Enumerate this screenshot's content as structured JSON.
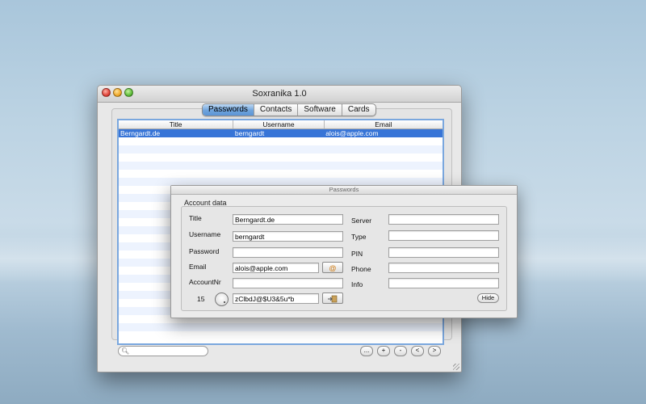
{
  "window": {
    "title": "Soxranika 1.0"
  },
  "tabs": [
    {
      "label": "Passwords",
      "active": true
    },
    {
      "label": "Contacts",
      "active": false
    },
    {
      "label": "Software",
      "active": false
    },
    {
      "label": "Cards",
      "active": false
    }
  ],
  "table": {
    "columns": [
      "Title",
      "Username",
      "Email"
    ],
    "rows": [
      {
        "title": "Berngardt.de",
        "username": "berngardt",
        "email": "alois@apple.com",
        "selected": true
      }
    ]
  },
  "footer": {
    "search_icon": "magnifier-icon",
    "buttons": [
      "...",
      "+",
      "-",
      "<",
      ">"
    ]
  },
  "panel": {
    "title": "Passwords",
    "group_label": "Account data",
    "left_fields": {
      "title": {
        "label": "Title",
        "value": "Berngardt.de"
      },
      "username": {
        "label": "Username",
        "value": "berngardt"
      },
      "password": {
        "label": "Password",
        "value": ""
      },
      "email": {
        "label": "Email",
        "value": "alois@apple.com"
      },
      "account_nr": {
        "label": "AccountNr",
        "value": ""
      }
    },
    "right_fields": {
      "server": {
        "label": "Server",
        "value": ""
      },
      "type": {
        "label": "Type",
        "value": ""
      },
      "pin": {
        "label": "PIN",
        "value": ""
      },
      "phone": {
        "label": "Phone",
        "value": ""
      },
      "info": {
        "label": "Info",
        "value": ""
      }
    },
    "generator": {
      "length": "15",
      "generated": "zClbdJ@$U3&5u*b"
    },
    "email_button": "@",
    "copy_button_icon": "paste-arrow-icon",
    "hide_button": "Hide"
  },
  "colors": {
    "selection": "#3875d7",
    "active_tab": "#6ea3dc",
    "table_border": "#7aa7de"
  }
}
